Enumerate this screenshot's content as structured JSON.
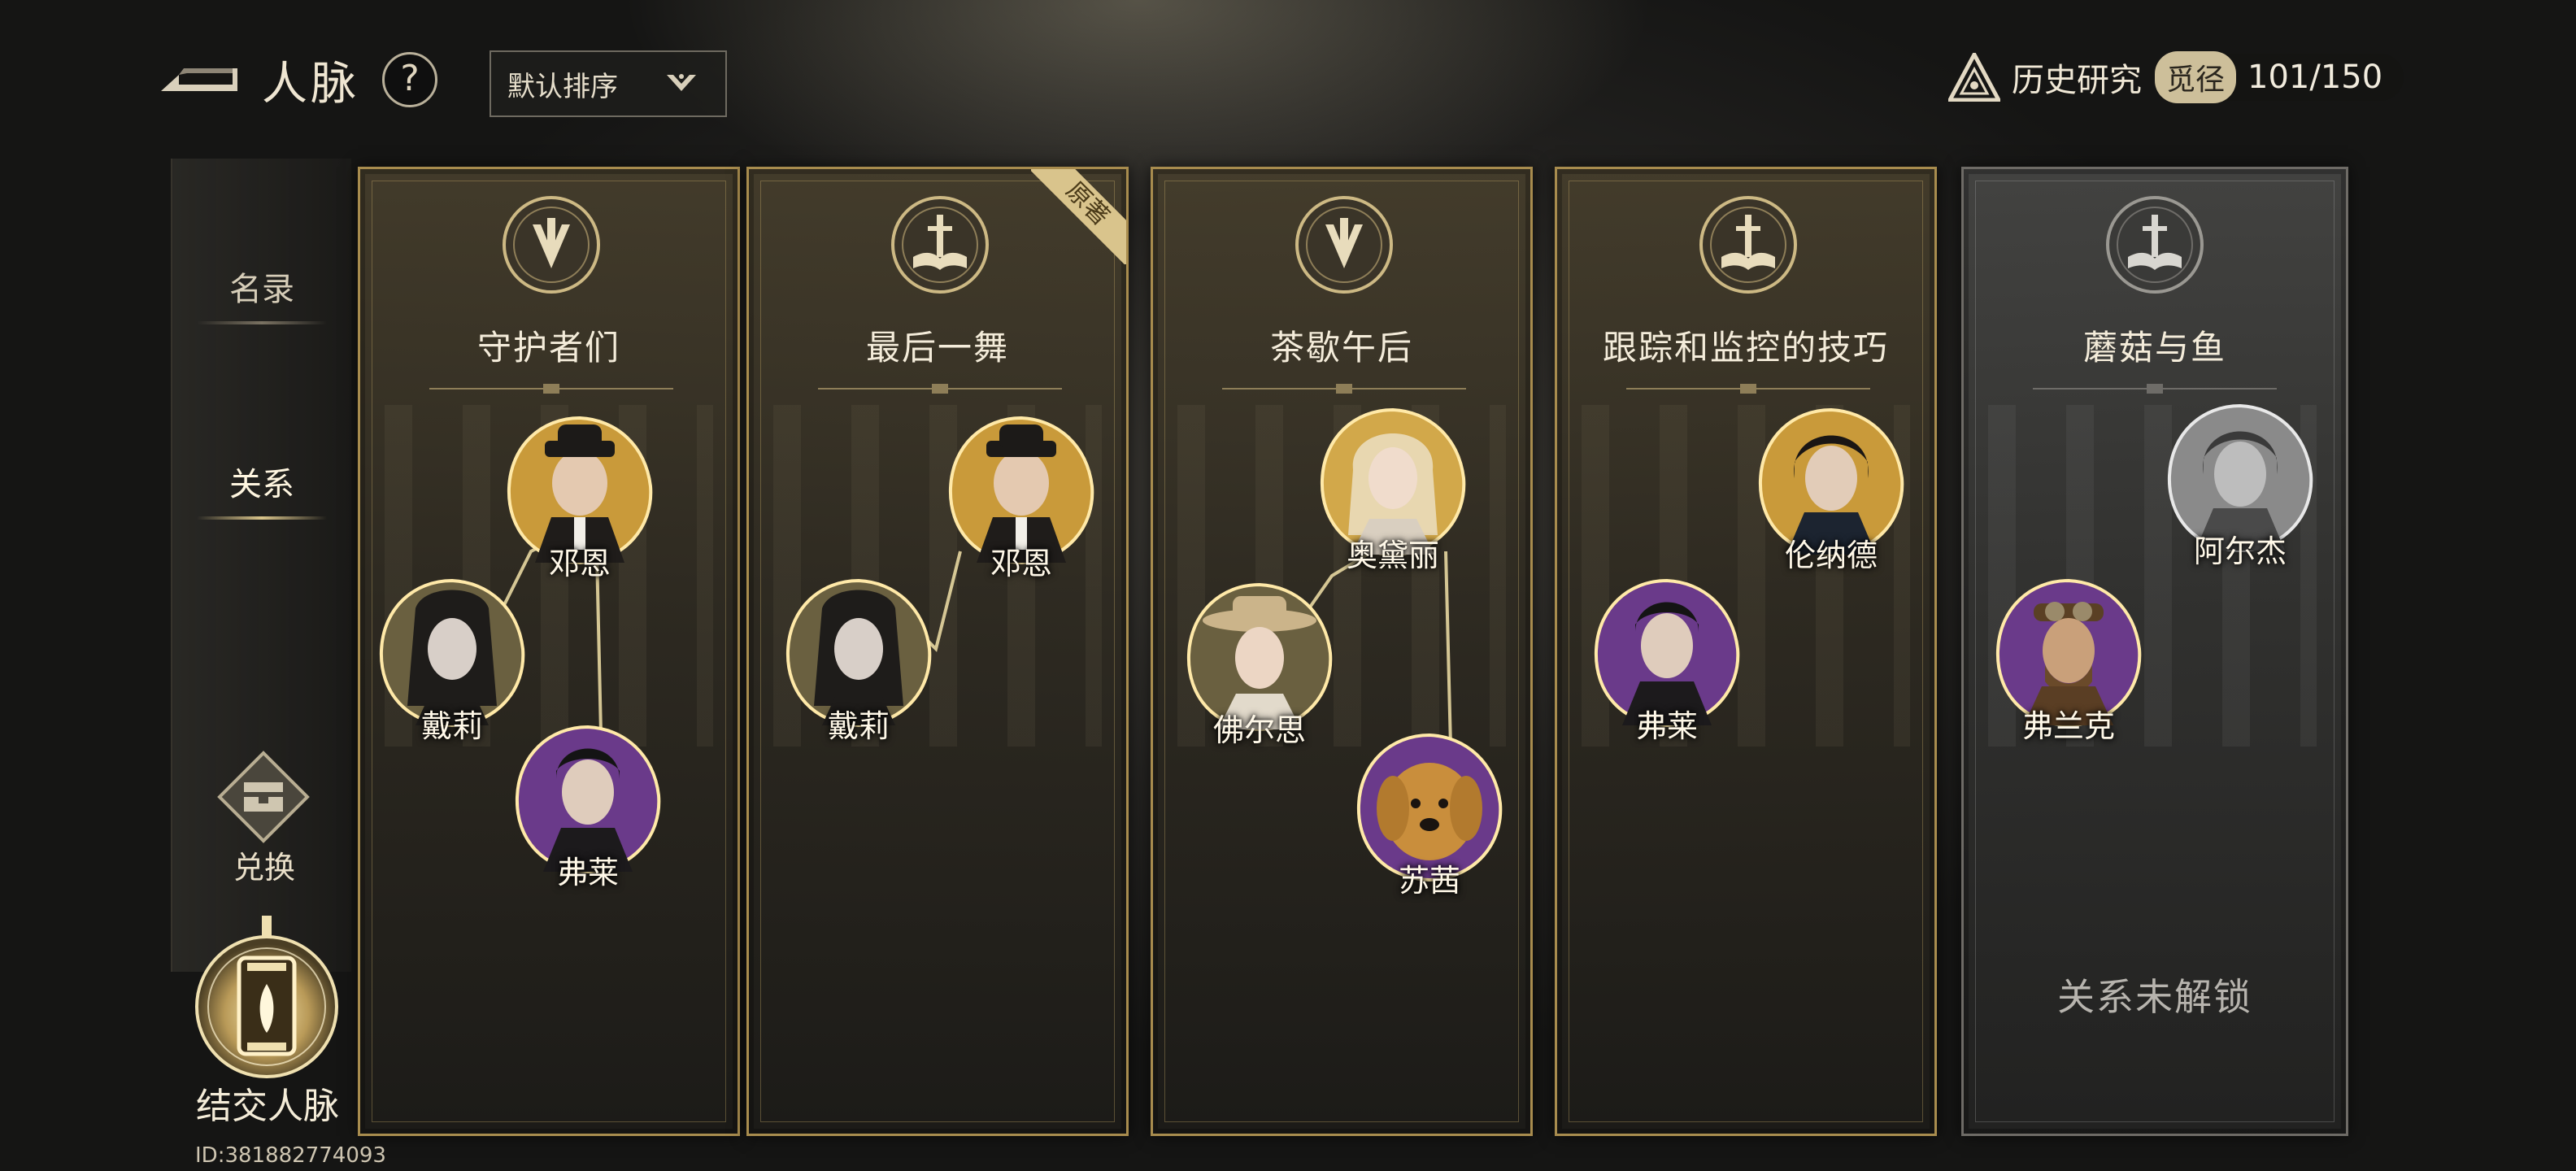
{
  "header": {
    "title": "人脉",
    "help_label": "?",
    "sort_label": "默认排序"
  },
  "research": {
    "label": "历史研究",
    "tag": "觅径",
    "progress": "101/150"
  },
  "sidebar": {
    "items": [
      {
        "label": "名录"
      },
      {
        "label": "关系"
      }
    ],
    "exchange_label": "兑换",
    "make_contacts_label": "结交人脉",
    "uid": "ID:381882774093"
  },
  "cards": [
    {
      "title": "守护者们",
      "ribbon": "",
      "emblem": "crest-icon",
      "characters": [
        {
          "name": "邓恩",
          "tint": "#c99a3a"
        },
        {
          "name": "戴莉",
          "tint": "#6a6040"
        },
        {
          "name": "弗莱",
          "tint": "#6a3a8a"
        }
      ]
    },
    {
      "title": "最后一舞",
      "ribbon": "原著",
      "emblem": "book-sword-icon",
      "characters": [
        {
          "name": "邓恩",
          "tint": "#c99a3a"
        },
        {
          "name": "戴莉",
          "tint": "#6a6040"
        }
      ]
    },
    {
      "title": "茶歇午后",
      "ribbon": "",
      "emblem": "crest-icon",
      "characters": [
        {
          "name": "奥黛丽",
          "tint": "#d2a84a"
        },
        {
          "name": "佛尔思",
          "tint": "#6a6040"
        },
        {
          "name": "苏茜",
          "tint": "#6a3a8a"
        }
      ]
    },
    {
      "title": "跟踪和监控的技巧",
      "ribbon": "",
      "emblem": "book-sword-icon",
      "characters": [
        {
          "name": "伦纳德",
          "tint": "#c99a3a"
        },
        {
          "name": "弗莱",
          "tint": "#6a3a8a"
        }
      ]
    },
    {
      "title": "蘑菇与鱼",
      "ribbon": "",
      "emblem": "book-sword-icon",
      "locked_text": "关系未解锁",
      "characters": [
        {
          "name": "阿尔杰",
          "tint": "#8a8a8a"
        },
        {
          "name": "弗兰克",
          "tint": "#6a3a8a"
        }
      ]
    }
  ]
}
